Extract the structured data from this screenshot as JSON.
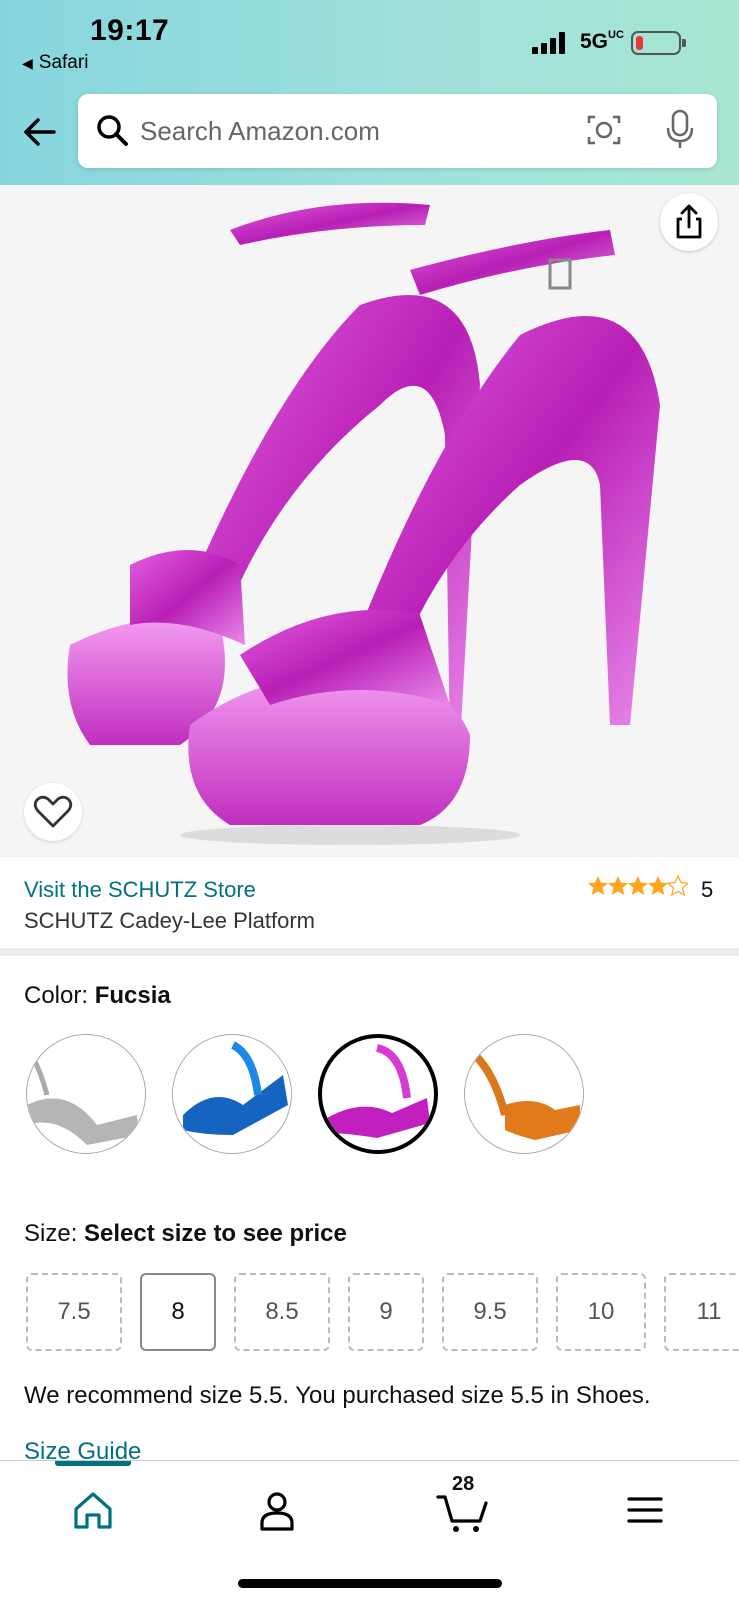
{
  "status_bar": {
    "time": "19:17",
    "back_app": "Safari",
    "network": "5G",
    "network_superscript": "UC"
  },
  "search": {
    "placeholder": "Search Amazon.com"
  },
  "product": {
    "store_link": "Visit the SCHUTZ Store",
    "title": "SCHUTZ Cadey-Lee Platform",
    "rating": 4.5,
    "rating_count": "5"
  },
  "color": {
    "label": "Color:",
    "selected": "Fucsia",
    "swatches": [
      {
        "name": "silver",
        "color": "#b0b0b0"
      },
      {
        "name": "blue",
        "color": "#1565c0"
      },
      {
        "name": "fucsia",
        "color": "#c21fbf"
      },
      {
        "name": "orange",
        "color": "#e07a1a"
      }
    ]
  },
  "size": {
    "label": "Size:",
    "prompt": "Select size to see price",
    "options": [
      "7.5",
      "8",
      "8.5",
      "9",
      "9.5",
      "10",
      "11"
    ],
    "available": "8",
    "recommendation": "We recommend size 5.5. You purchased size 5.5 in Shoes.",
    "guide_link": "Size Guide"
  },
  "bottom_nav": {
    "items": [
      "home-icon",
      "account-icon",
      "cart-icon",
      "menu-icon"
    ],
    "cart_count": "28",
    "active": "home"
  },
  "colors": {
    "accent": "#007185",
    "star": "#ffa41c",
    "header_gradient_start": "#86d5de",
    "header_gradient_end": "#a8e6d2"
  }
}
